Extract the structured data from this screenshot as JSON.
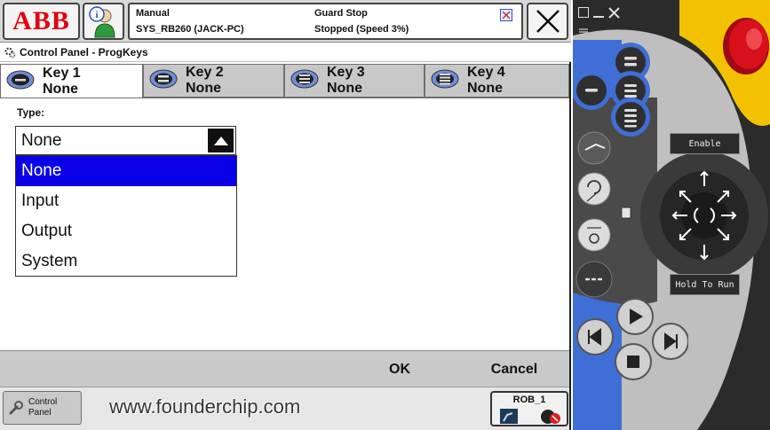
{
  "topbar": {
    "logo_text": "ABB",
    "status": {
      "mode": "Manual",
      "system": "SYS_RB260 (JACK-PC)",
      "guard": "Guard Stop",
      "state": "Stopped (Speed 3%)"
    }
  },
  "window_title": "Control Panel - ProgKeys",
  "tabs": [
    {
      "label": "Key 1",
      "value": "None",
      "active": true
    },
    {
      "label": "Key 2",
      "value": "None",
      "active": false
    },
    {
      "label": "Key 3",
      "value": "None",
      "active": false
    },
    {
      "label": "Key 4",
      "value": "None",
      "active": false
    }
  ],
  "form": {
    "type_label": "Type:",
    "type_value": "None",
    "options": [
      "None",
      "Input",
      "Output",
      "System"
    ],
    "selected_option": "None"
  },
  "actions": {
    "ok_label": "OK",
    "cancel_label": "Cancel"
  },
  "taskbar": {
    "control_panel_line1": "Control",
    "control_panel_line2": "Panel",
    "watermark": "www.founderchip.com",
    "rob_label": "ROB_1"
  },
  "pendant": {
    "enable_label": "Enable",
    "hold_to_run_label": "Hold To Run"
  },
  "colors": {
    "abb_red": "#e3000f",
    "selection_blue": "#0a00e6",
    "pendant_blue": "#3f6fd6",
    "pendant_yellow": "#f2c200",
    "emergency_red": "#d8101c"
  }
}
